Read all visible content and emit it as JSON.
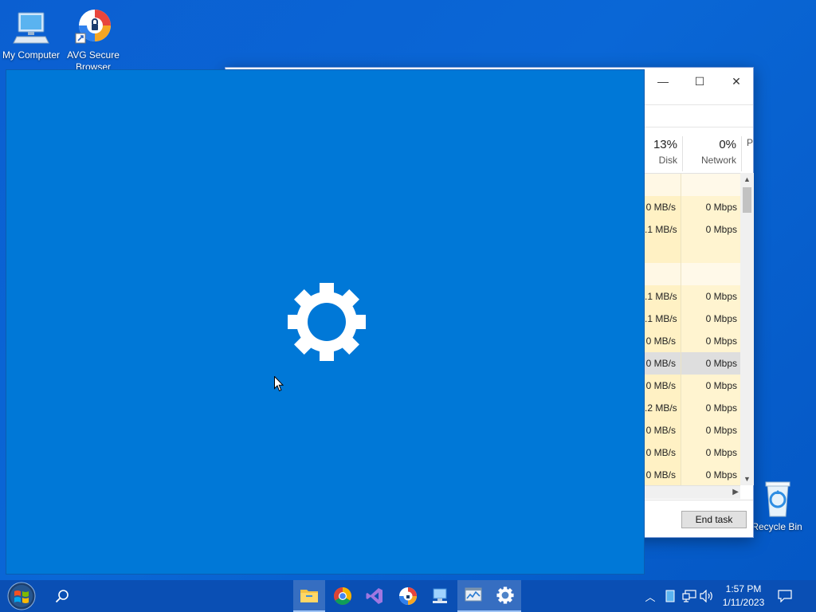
{
  "desktop": {
    "icons": [
      {
        "label": "My Computer"
      },
      {
        "label": "AVG Secure Browser"
      },
      {
        "label": "Recycle Bin"
      }
    ]
  },
  "task_manager": {
    "minimize_glyph": "—",
    "maximize_glyph": "☐",
    "close_glyph": "✕",
    "columns": [
      {
        "percent": "13%",
        "label": "Disk"
      },
      {
        "percent": "0%",
        "label": "Network"
      },
      {
        "percent": "",
        "label": "P"
      }
    ],
    "rows": [
      {
        "disk": "",
        "network": "",
        "highlight": "light"
      },
      {
        "disk": "0 MB/s",
        "network": "0 Mbps",
        "highlight": "yellow"
      },
      {
        "disk": ".1 MB/s",
        "network": "0 Mbps",
        "highlight": "yellow"
      },
      {
        "disk": "",
        "network": "",
        "highlight": "yellow"
      },
      {
        "disk": "",
        "network": "",
        "highlight": "light"
      },
      {
        "disk": ".1 MB/s",
        "network": "0 Mbps",
        "highlight": "yellow"
      },
      {
        "disk": ".1 MB/s",
        "network": "0 Mbps",
        "highlight": "yellow"
      },
      {
        "disk": "0 MB/s",
        "network": "0 Mbps",
        "highlight": "yellow"
      },
      {
        "disk": "0 MB/s",
        "network": "0 Mbps",
        "highlight": "selected"
      },
      {
        "disk": "0 MB/s",
        "network": "0 Mbps",
        "highlight": "yellow"
      },
      {
        "disk": ".2 MB/s",
        "network": "0 Mbps",
        "highlight": "yellow"
      },
      {
        "disk": "0 MB/s",
        "network": "0 Mbps",
        "highlight": "yellow"
      },
      {
        "disk": "0 MB/s",
        "network": "0 Mbps",
        "highlight": "yellow"
      },
      {
        "disk": "0 MB/s",
        "network": "0 Mbps",
        "highlight": "yellow"
      }
    ],
    "end_task_label": "End task"
  },
  "settings_splash": {
    "icon": "gear-icon",
    "background": "#0078d7"
  },
  "taskbar": {
    "start_icon": "windows-start-orb",
    "search_icon": "search-icon",
    "pinned": [
      {
        "name": "file-explorer-icon",
        "active": true
      },
      {
        "name": "chrome-icon",
        "active": false
      },
      {
        "name": "visual-studio-icon",
        "active": false
      },
      {
        "name": "avg-browser-icon",
        "active": false
      },
      {
        "name": "pc-icon",
        "active": false
      },
      {
        "name": "task-manager-icon",
        "active": true
      },
      {
        "name": "settings-icon",
        "active": true
      }
    ],
    "tray": {
      "chevron": "︿",
      "time": "1:57 PM",
      "date": "1/11/2023"
    }
  }
}
